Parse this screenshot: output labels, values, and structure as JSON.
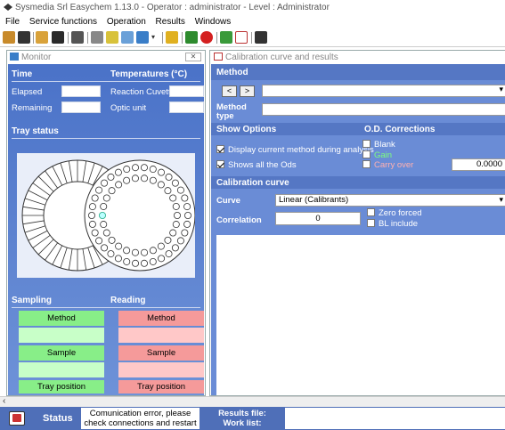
{
  "app": {
    "title": "Sysmedia Srl Easychem 1.13.0 - Operator : administrator - Level : Administrator"
  },
  "menu": [
    "File",
    "Service functions",
    "Operation",
    "Results",
    "Windows"
  ],
  "toolbar": {
    "icons": [
      "open-icon",
      "save-icon",
      "edit-icon",
      "disk-icon",
      "print-icon",
      "search-icon",
      "chart-icon",
      "report-icon",
      "sample-icon",
      "dropdown-icon",
      "wrench-icon",
      "bug-icon",
      "stop-icon",
      "tools-icon",
      "calibration-icon",
      "exit-icon"
    ]
  },
  "monitor": {
    "title": "Monitor",
    "time_header": "Time",
    "elapsed_label": "Elapsed",
    "remaining_label": "Remaining",
    "temp_header": "Temperatures (°C)",
    "cuvette_label": "Reaction Cuvette",
    "optic_label": "Optic unit",
    "tray_header": "Tray status",
    "sampling_header": "Sampling",
    "reading_header": "Reading",
    "sampling_rows": [
      "Method",
      "",
      "Sample",
      "",
      "Tray position",
      ""
    ],
    "reading_rows": [
      "Method",
      "",
      "Sample",
      "",
      "Tray position",
      ""
    ]
  },
  "calibration": {
    "title": "Calibration curve and results",
    "method_header": "Method",
    "prev_label": "<",
    "next_label": ">",
    "method_type_label": "Method type",
    "show_options_header": "Show Options",
    "od_header": "O.D. Corrections",
    "opt_display": "Display current method during analysis",
    "opt_show_ods": "Shows all the Ods",
    "blank_label": "Blank",
    "gain_label": "Gain",
    "carry_label": "Carry over",
    "carry_value": "0.0000",
    "curve_header": "Calibration curve",
    "curve_label": "Curve",
    "curve_value": "Linear (Calibrants)",
    "correlation_label": "Correlation",
    "correlation_value": "0",
    "zero_forced_label": "Zero forced",
    "bl_include_label": "BL include",
    "colors": {
      "blank": "#ffffff",
      "gain": "#7dff7d",
      "carry": "#ffb0b0"
    }
  },
  "status": {
    "label": "Status",
    "message": "Comunication error, please check connections and restart",
    "results_label": "Results file:",
    "worklist_label": "Work list:"
  }
}
